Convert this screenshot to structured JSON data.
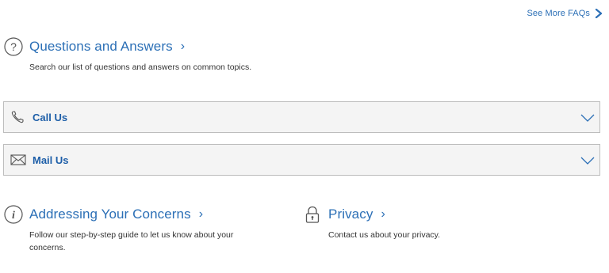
{
  "header": {
    "see_more_label": "See More FAQs"
  },
  "qa": {
    "title": "Questions and Answers",
    "description": "Search our list of questions and answers on common topics."
  },
  "accordions": [
    {
      "label": "Call Us"
    },
    {
      "label": "Mail Us"
    }
  ],
  "concerns": {
    "title": "Addressing Your Concerns",
    "description": "Follow our step-by-step guide to let us know about your concerns."
  },
  "privacy": {
    "title": "Privacy",
    "description": "Contact us about your privacy."
  },
  "colors": {
    "link_blue": "#2b6fb6",
    "heading_blue": "#1d5ea8",
    "row_background": "#f4f4f4",
    "row_border": "#bdbdbd",
    "text": "#333333"
  },
  "icons": {
    "see_more": "chevron-right-icon",
    "qa": "question-circle-icon",
    "call": "phone-icon",
    "mail": "envelope-icon",
    "concerns": "info-circle-icon",
    "privacy": "lock-icon",
    "accordion_toggle": "chevron-down-icon"
  }
}
